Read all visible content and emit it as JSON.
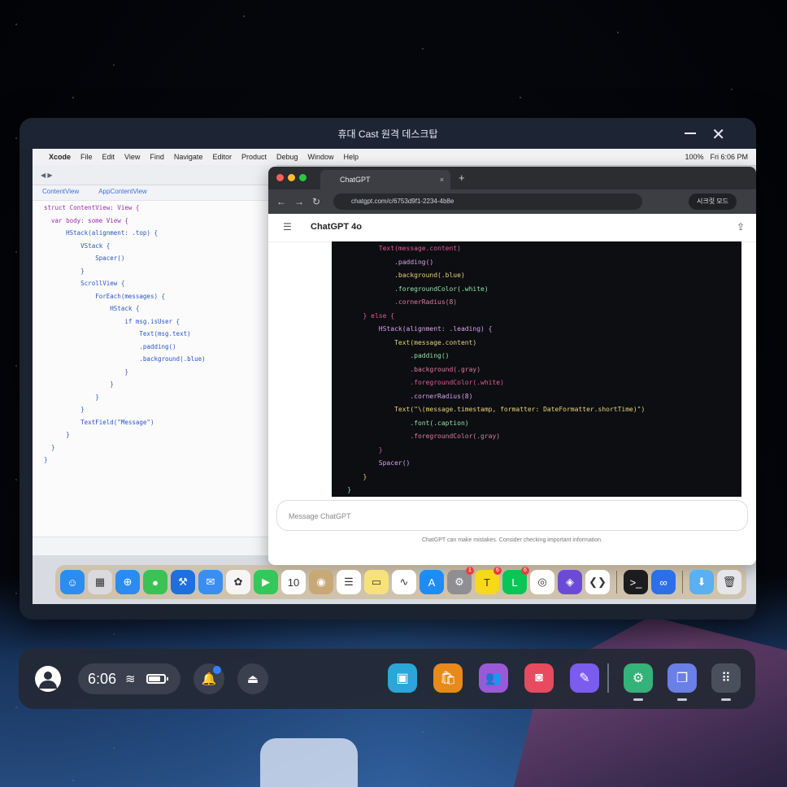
{
  "window": {
    "title": "휴대 Cast 원격 데스크탑",
    "minimize_label": "–",
    "close_label": "✕"
  },
  "remote": {
    "menubar": {
      "items": [
        "",
        "Xcode",
        "File",
        "Edit",
        "View",
        "Find",
        "Navigate",
        "Editor",
        "Product",
        "Debug",
        "Window",
        "Help"
      ],
      "right": [
        "100%",
        "Fri 6:06 PM"
      ]
    },
    "xcode": {
      "tabs": [
        "ContentView",
        "AppContentView"
      ],
      "code": [
        "struct ContentView: View {",
        "  var body: some View {",
        "      HStack(alignment: .top) {",
        "          VStack {",
        "              Spacer()",
        "          }",
        "          ScrollView {",
        "              ForEach(messages) {",
        "                  HStack {",
        "                      if msg.isUser {",
        "                          Text(msg.text)",
        "                          .padding()",
        "                          .background(.blue)",
        "                      }",
        "                  }",
        "              }",
        "          }",
        "          TextField(\"Message\")",
        "      }",
        "  }",
        "}"
      ]
    },
    "browser": {
      "tab_title": "ChatGPT",
      "url": "chatgpt.com/c/6753d9f1-2234-4b8e",
      "profile": "시크릿 모드",
      "chat_title": "ChatGPT 4o",
      "code": [
        "            Text(message.content)",
        "                .padding()",
        "                .background(.blue)",
        "                .foregroundColor(.white)",
        "                .cornerRadius(8)",
        "        } else {",
        "            HStack(alignment: .leading) {",
        "                Text(message.content)",
        "                    .padding()",
        "                    .background(.gray)",
        "                    .foregroundColor(.white)",
        "                    .cornerRadius(8)",
        "                Text(\"\\(message.timestamp, formatter: DateFormatter.shortTime)\")",
        "                    .font(.caption)",
        "                    .foregroundColor(.gray)",
        "            }",
        "            Spacer()",
        "        }",
        "    }"
      ],
      "input_placeholder": "Message ChatGPT",
      "footer": "ChatGPT can make mistakes. Consider checking important information."
    },
    "dock": {
      "icons": [
        {
          "name": "finder-icon",
          "color": "#2d8cf0",
          "glyph": "☺"
        },
        {
          "name": "launchpad-icon",
          "color": "#d9d9de",
          "glyph": "▦"
        },
        {
          "name": "safari-icon",
          "color": "#2b8bf0",
          "glyph": "⊕"
        },
        {
          "name": "messages-icon",
          "color": "#3ac255",
          "glyph": "●"
        },
        {
          "name": "xcode-icon",
          "color": "#1f6fe0",
          "glyph": "⚒"
        },
        {
          "name": "mail-icon",
          "color": "#3a8ef2",
          "glyph": "✉"
        },
        {
          "name": "photos-icon",
          "color": "#f5f5f5",
          "glyph": "✿"
        },
        {
          "name": "facetime-icon",
          "color": "#34c759",
          "glyph": "▶"
        },
        {
          "name": "calendar-icon",
          "color": "#ffffff",
          "glyph": "10"
        },
        {
          "name": "contacts-icon",
          "color": "#c9a877",
          "glyph": "◉"
        },
        {
          "name": "reminders-icon",
          "color": "#ffffff",
          "glyph": "☰"
        },
        {
          "name": "notes-icon",
          "color": "#f7e27a",
          "glyph": "▭"
        },
        {
          "name": "freeform-icon",
          "color": "#ffffff",
          "glyph": "∿"
        },
        {
          "name": "app-store-icon",
          "color": "#1e8cf5",
          "glyph": "A"
        },
        {
          "name": "system-settings-icon",
          "color": "#8e8e93",
          "glyph": "⚙",
          "badge": "1"
        },
        {
          "name": "kakaotalk-icon",
          "color": "#f7d81b",
          "glyph": "T",
          "badge": "6"
        },
        {
          "name": "line-icon",
          "color": "#06c755",
          "glyph": "L",
          "badge": "6"
        },
        {
          "name": "chrome-icon",
          "color": "#ffffff",
          "glyph": "◎"
        },
        {
          "name": "github-icon",
          "color": "#6b4bd6",
          "glyph": "◈"
        },
        {
          "name": "vscode-icon",
          "color": "#ffffff",
          "glyph": "❮❯"
        },
        {
          "name": "terminal-icon",
          "color": "#1c1c1e",
          "glyph": ">_"
        },
        {
          "name": "meta-icon",
          "color": "#2d6fe8",
          "glyph": "∞"
        },
        {
          "name": "downloads-folder-icon",
          "color": "#5ab0f0",
          "glyph": "⬇"
        },
        {
          "name": "trash-icon",
          "color": "#e6e6ea",
          "glyph": "🗑"
        }
      ]
    }
  },
  "taskbar": {
    "time": "6:06",
    "battery_level": 0.8,
    "apps": [
      {
        "name": "app-gallery-icon",
        "color": "#2aa6d9",
        "glyph": "▣"
      },
      {
        "name": "store-icon",
        "color": "#e8891b",
        "glyph": "🛍"
      },
      {
        "name": "community-icon",
        "color": "#9a59d6",
        "glyph": "👥"
      },
      {
        "name": "camera-icon",
        "color": "#e84a5f",
        "glyph": "◙"
      },
      {
        "name": "pen-icon",
        "color": "#7b5cf0",
        "glyph": "✎"
      },
      {
        "name": "settings-icon",
        "color": "#33b37a",
        "glyph": "⚙"
      },
      {
        "name": "multitask-icon",
        "color": "#6a7fe8",
        "glyph": "❐"
      },
      {
        "name": "app-drawer-icon",
        "color": "#4a4f5c",
        "glyph": "⠿"
      }
    ]
  }
}
